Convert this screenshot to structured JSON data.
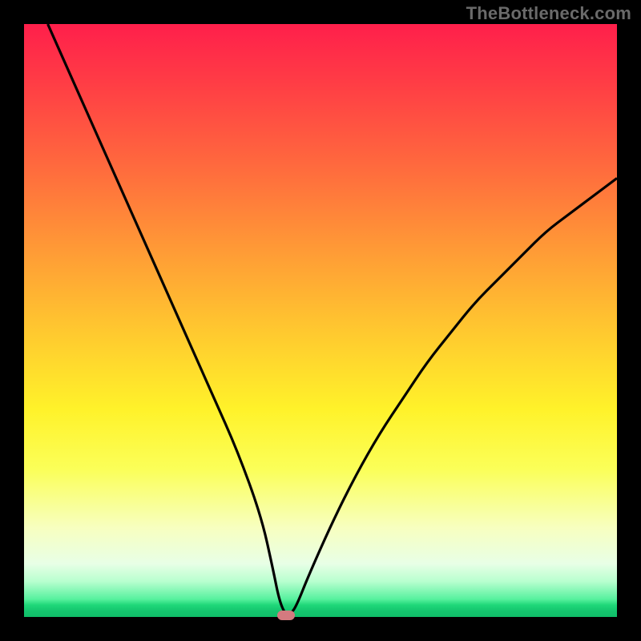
{
  "watermark": "TheBottleneck.com",
  "colors": {
    "background": "#000000",
    "gradient_top": "#ff1f4b",
    "gradient_mid": "#fff22a",
    "gradient_bottom": "#10bd68",
    "curve": "#000000",
    "marker": "#d47a7f"
  },
  "chart_data": {
    "type": "line",
    "title": "",
    "xlabel": "",
    "ylabel": "",
    "xlim": [
      0,
      100
    ],
    "ylim": [
      0,
      100
    ],
    "series": [
      {
        "name": "bottleneck-curve",
        "x": [
          4,
          8,
          12,
          16,
          20,
          24,
          28,
          32,
          36,
          40,
          42,
          43,
          44,
          45,
          46,
          48,
          52,
          56,
          60,
          64,
          68,
          72,
          76,
          80,
          84,
          88,
          92,
          96,
          100
        ],
        "y": [
          100,
          91,
          82,
          73,
          64,
          55,
          46,
          37,
          28,
          17,
          8,
          3,
          0.5,
          0.5,
          2,
          7,
          16,
          24,
          31,
          37,
          43,
          48,
          53,
          57,
          61,
          65,
          68,
          71,
          74
        ]
      }
    ],
    "marker": {
      "x": 44.2,
      "y": 0.3
    },
    "annotations": []
  }
}
